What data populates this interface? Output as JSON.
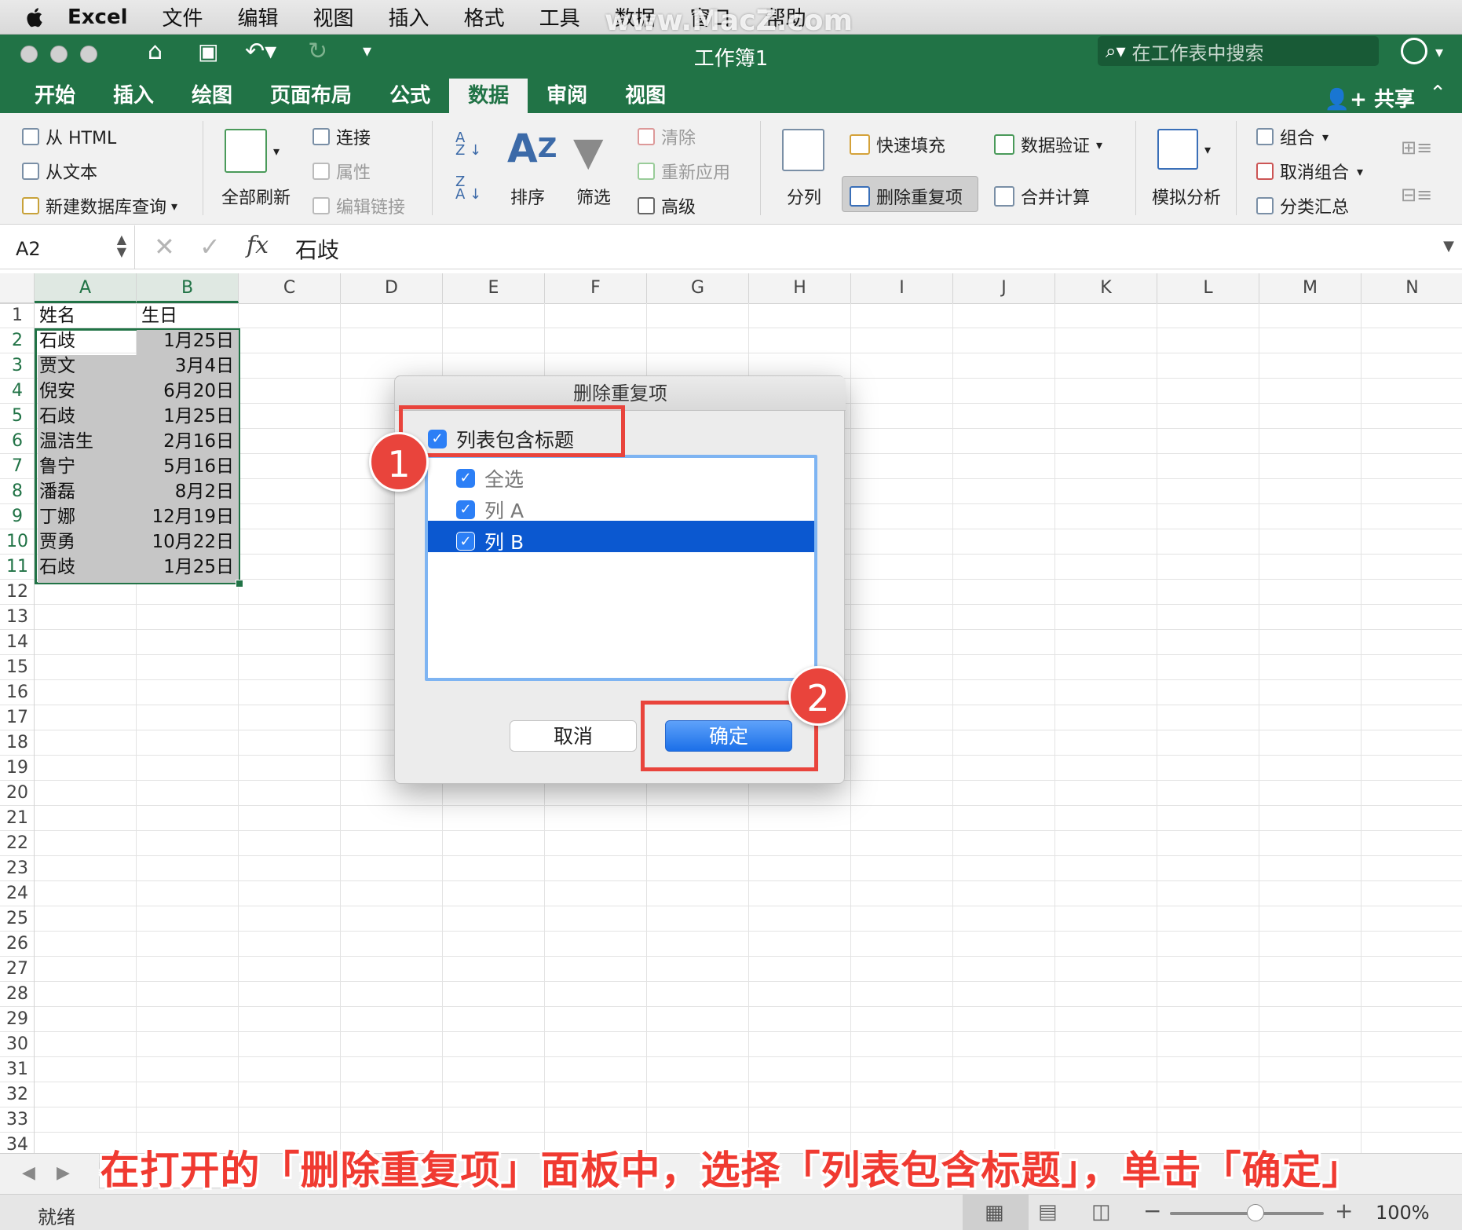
{
  "menubar": {
    "app": "Excel",
    "items": [
      "文件",
      "编辑",
      "视图",
      "插入",
      "格式",
      "工具",
      "数据",
      "窗口",
      "帮助"
    ]
  },
  "watermark": "www.MacZ.com",
  "titlebar": {
    "title": "工作簿1",
    "search_placeholder": "在工作表中搜索"
  },
  "tabs": [
    "开始",
    "插入",
    "绘图",
    "页面布局",
    "公式",
    "数据",
    "审阅",
    "视图"
  ],
  "active_tab": "数据",
  "share_label": "共享",
  "ribbon": {
    "from_html": "从 HTML",
    "from_text": "从文本",
    "new_db_query": "新建数据库查询",
    "refresh_all": "全部刷新",
    "connections": "连接",
    "properties": "属性",
    "edit_links": "编辑链接",
    "sort": "排序",
    "filter": "筛选",
    "clear": "清除",
    "reapply": "重新应用",
    "advanced": "高级",
    "text_to_columns": "分列",
    "flash_fill": "快速填充",
    "remove_duplicates": "删除重复项",
    "data_validation": "数据验证",
    "consolidate": "合并计算",
    "what_if": "模拟分析",
    "group": "组合",
    "ungroup": "取消组合",
    "subtotal": "分类汇总"
  },
  "formula_bar": {
    "name_box": "A2",
    "fx": "fx",
    "value": "石歧"
  },
  "columns": [
    "A",
    "B",
    "C",
    "D",
    "E",
    "F",
    "G",
    "H",
    "I",
    "J",
    "K",
    "L",
    "M",
    "N"
  ],
  "rows": [
    "1",
    "2",
    "3",
    "4",
    "5",
    "6",
    "7",
    "8",
    "9",
    "10",
    "11",
    "12",
    "13",
    "14",
    "15",
    "16",
    "17",
    "18",
    "19",
    "20",
    "21",
    "22",
    "23",
    "24",
    "25",
    "26",
    "27",
    "28",
    "29",
    "30",
    "31",
    "32",
    "33",
    "34"
  ],
  "sheet": {
    "header": [
      "姓名",
      "生日"
    ],
    "data": [
      [
        "石歧",
        "1月25日"
      ],
      [
        "贾文",
        "3月4日"
      ],
      [
        "倪安",
        "6月20日"
      ],
      [
        "石歧",
        "1月25日"
      ],
      [
        "温洁生",
        "2月16日"
      ],
      [
        "鲁宁",
        "5月16日"
      ],
      [
        "潘磊",
        "8月2日"
      ],
      [
        "丁娜",
        "12月19日"
      ],
      [
        "贾勇",
        "10月22日"
      ],
      [
        "石歧",
        "1月25日"
      ]
    ]
  },
  "dialog": {
    "title": "删除重复项",
    "header_checkbox": "列表包含标题",
    "items": [
      "全选",
      "列 A",
      "列 B"
    ],
    "cancel": "取消",
    "ok": "确定"
  },
  "annotations": {
    "step1": "1",
    "step2": "2"
  },
  "caption": "在打开的「删除重复项」面板中，选择「列表包含标题」，单击「确定」",
  "statusbar": {
    "status": "就绪",
    "zoom": "100%"
  },
  "colors": {
    "excel_green": "#217346",
    "annotation_red": "#e9443c",
    "selection_blue": "#0b58d0"
  }
}
